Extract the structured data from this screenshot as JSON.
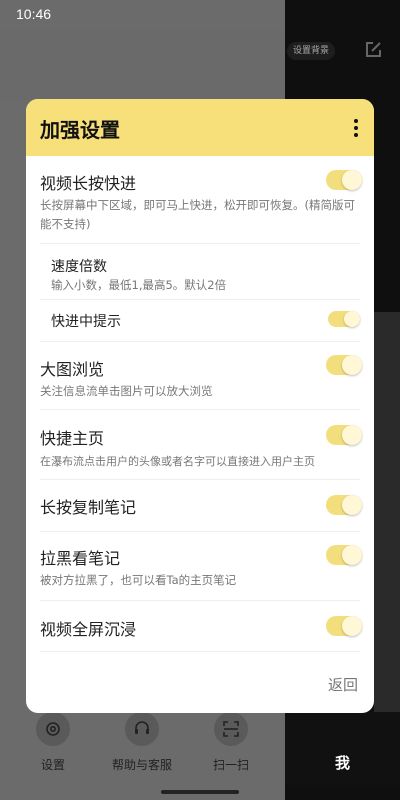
{
  "status_bar": {
    "time": "10:46"
  },
  "background": {
    "top_chip": "设置背景",
    "nav": [
      {
        "label": "设置",
        "icon": "gear-icon"
      },
      {
        "label": "帮助与客服",
        "icon": "headset-icon"
      },
      {
        "label": "扫一扫",
        "icon": "scan-icon"
      }
    ],
    "me_label": "我"
  },
  "dialog": {
    "title": "加强设置",
    "back_label": "返回",
    "settings": [
      {
        "title": "视频长按快进",
        "desc": "长按屏幕中下区域，即可马上快进，松开即可恢复。(精简版可能不支持)",
        "enabled": true
      },
      {
        "title": "速度倍数",
        "desc": "输入小数，最低1,最高5。默认2倍"
      },
      {
        "title": "快进中提示",
        "enabled": true
      },
      {
        "title": "大图浏览",
        "desc": "关注信息流单击图片可以放大浏览",
        "enabled": true
      },
      {
        "title": "快捷主页",
        "desc": "在瀑布流点击用户的头像或者名字可以直接进入用户主页",
        "enabled": true
      },
      {
        "title": "长按复制笔记",
        "enabled": true
      },
      {
        "title": "拉黑看笔记",
        "desc": "被对方拉黑了，也可以看Ta的主页笔记",
        "enabled": true
      },
      {
        "title": "视频全屏沉浸",
        "enabled": true
      }
    ]
  },
  "colors": {
    "accent": "#f7e07a",
    "toggle_track": "#f3de7d"
  }
}
